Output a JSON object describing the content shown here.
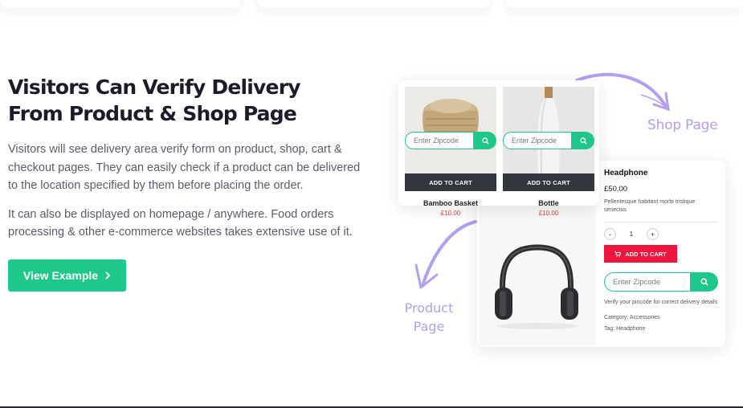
{
  "heading": "Visitors Can Verify Delivery From Product & Shop Page",
  "paragraphs": [
    "Visitors will see delivery area verify form on product, shop, cart & checkout pages. They can easily check if a product can be delivered to the location specified by them before placing the order.",
    "It can also be displayed on homepage / anywhere. Food orders processing & other e-commerce websites takes extensive use of it."
  ],
  "cta": {
    "label": "View Example",
    "icon": "chevron-right-icon"
  },
  "illustration": {
    "shop_label": "Shop Page",
    "product_label_line1": "Product",
    "product_label_line2": "Page",
    "shop_items": [
      {
        "name": "Bamboo Basket",
        "price": "£10.00",
        "zip_placeholder": "Enter Zipcode",
        "button": "ADD TO CART"
      },
      {
        "name": "Bottle",
        "price": "£10.00",
        "zip_placeholder": "Enter Zipcode",
        "button": "ADD TO CART"
      }
    ],
    "product": {
      "title": "Headphone",
      "price": "£50.00",
      "description": "Pellentesque habitant morbi tristique senectus",
      "quantity": "1",
      "minus": "-",
      "plus": "+",
      "add_to_cart": "ADD TO CART",
      "zip_placeholder": "Enter Zipcode",
      "verify_text": "Verify your pincode for correct delivery details",
      "category": "Category: Accessories",
      "tag": "Tag: Headphone"
    }
  },
  "colors": {
    "accent": "#1ec88a",
    "red": "#f0143c",
    "dark": "#33363d",
    "lavender": "#b49ef0"
  }
}
